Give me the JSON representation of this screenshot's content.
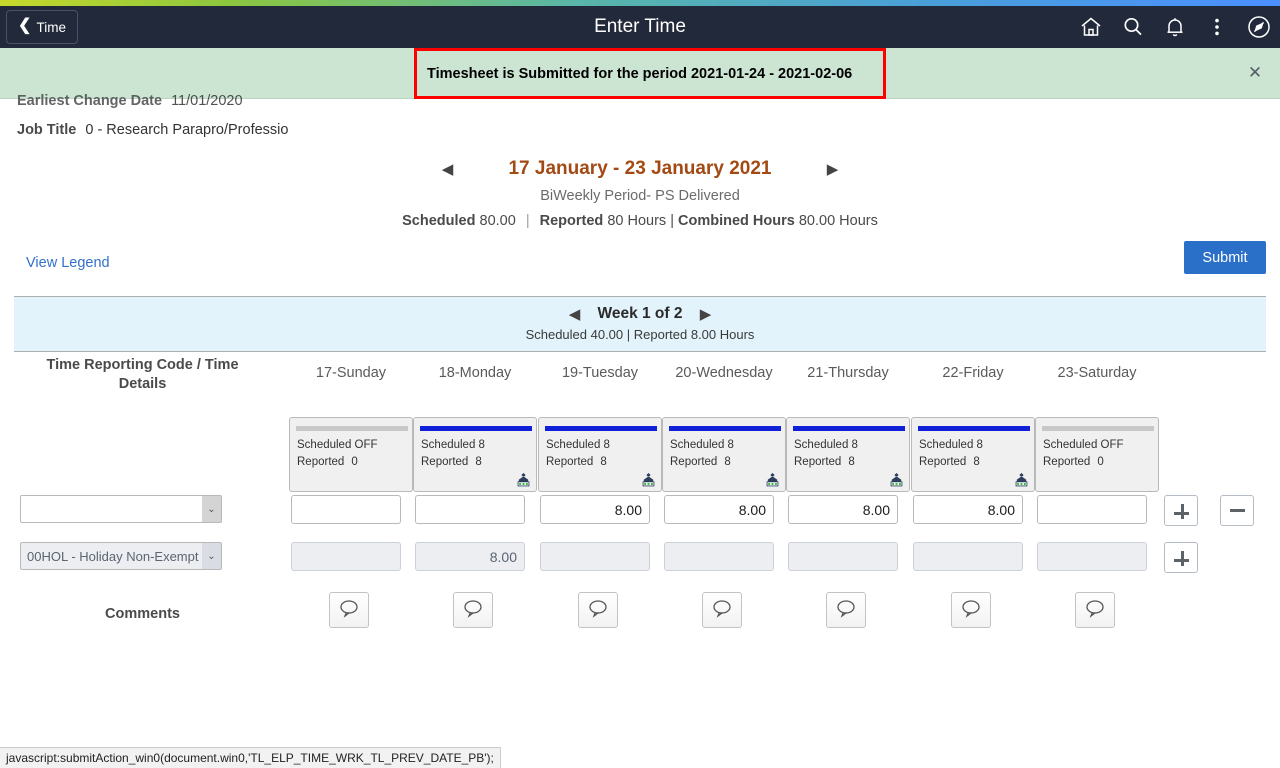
{
  "header": {
    "back_label": "Time",
    "title": "Enter Time",
    "icons": [
      {
        "name": "home-icon",
        "label": "Home"
      },
      {
        "name": "search-icon",
        "label": "Search"
      },
      {
        "name": "notifications-bell-icon",
        "label": "Notifications"
      },
      {
        "name": "actions-menu-icon",
        "label": "Actions"
      },
      {
        "name": "navbar-compass-icon",
        "label": "NavBar"
      }
    ],
    "background_color": "#21293a"
  },
  "message": {
    "text": "Timesheet is Submitted for the period 2021-01-24 - 2021-02-06",
    "close_label": "✕",
    "background_color": "#cce5d3",
    "border_color": "#ff0000"
  },
  "fields": [
    {
      "label": "Earliest Change Date",
      "value": "11/01/2020"
    },
    {
      "label": "Job Title",
      "value": "0 - Research Parapro/Professio"
    }
  ],
  "period": {
    "prev_arrow": "◀",
    "next_arrow": "▶",
    "label": "17 January - 23 January 2021",
    "type": "BiWeekly Period- PS Delivered",
    "scheduled_label": "Scheduled",
    "scheduled_value": "80.00",
    "reported_label": "Reported",
    "reported_value": "80 Hours",
    "combined_label": "Combined Hours",
    "combined_value": "80.00 Hours",
    "accent_color": "#a34a14"
  },
  "actions": {
    "view_legend": "View Legend",
    "submit": "Submit",
    "submit_color": "#2a70c8"
  },
  "week": {
    "prev_arrow": "◀",
    "next_arrow": "▶",
    "label": "Week 1 of 2",
    "totals": "Scheduled  40.00 | Reported  8.00 Hours",
    "background_color": "#e2f3fb"
  },
  "grid": {
    "trc_header": "Time Reporting Code / Time Details",
    "comments_label": "Comments",
    "days": [
      {
        "header": "17-Sunday",
        "bar": "gray",
        "scheduled": "Scheduled OFF",
        "reported_label": "Reported",
        "reported_value": "0",
        "has_icon": false
      },
      {
        "header": "18-Monday",
        "bar": "blue",
        "scheduled": "Scheduled 8",
        "reported_label": "Reported",
        "reported_value": "8",
        "has_icon": true
      },
      {
        "header": "19-Tuesday",
        "bar": "blue",
        "scheduled": "Scheduled 8",
        "reported_label": "Reported",
        "reported_value": "8",
        "has_icon": true
      },
      {
        "header": "20-Wednesday",
        "bar": "blue",
        "scheduled": "Scheduled 8",
        "reported_label": "Reported",
        "reported_value": "8",
        "has_icon": true
      },
      {
        "header": "21-Thursday",
        "bar": "blue",
        "scheduled": "Scheduled 8",
        "reported_label": "Reported",
        "reported_value": "8",
        "has_icon": true
      },
      {
        "header": "22-Friday",
        "bar": "blue",
        "scheduled": "Scheduled 8",
        "reported_label": "Reported",
        "reported_value": "8",
        "has_icon": true
      },
      {
        "header": "23-Saturday",
        "bar": "gray",
        "scheduled": "Scheduled OFF",
        "reported_label": "Reported",
        "reported_value": "0",
        "has_icon": false
      }
    ],
    "rows": [
      {
        "trc_value": "",
        "trc_disabled": false,
        "inputs_disabled": false,
        "values": [
          "",
          "",
          "8.00",
          "8.00",
          "8.00",
          "8.00",
          ""
        ],
        "add_button": "+",
        "remove_button": "−",
        "has_remove": true
      },
      {
        "trc_value": "00HOL - Holiday Non-Exempt",
        "trc_disabled": true,
        "inputs_disabled": true,
        "values": [
          "",
          "8.00",
          "",
          "",
          "",
          "",
          ""
        ],
        "add_button": "+",
        "remove_button": "",
        "has_remove": false
      }
    ]
  },
  "status_bar": {
    "text": "javascript:submitAction_win0(document.win0,'TL_ELP_TIME_WRK_TL_PREV_DATE_PB');"
  }
}
